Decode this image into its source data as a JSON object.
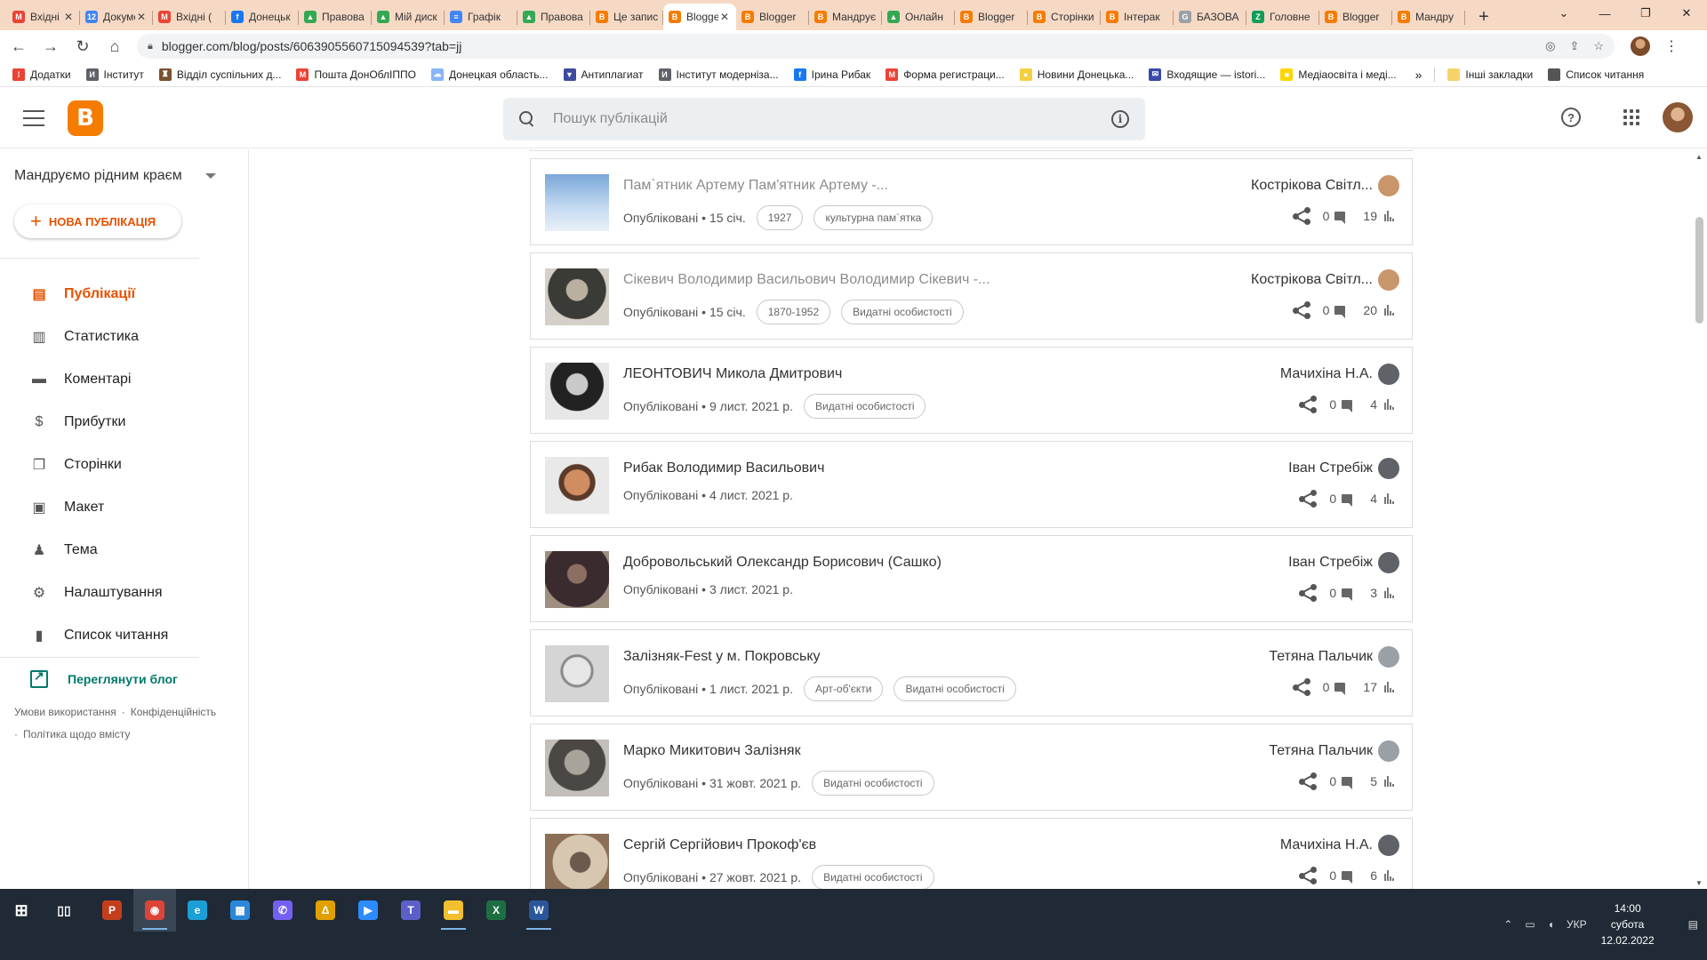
{
  "browser": {
    "tabs": [
      {
        "label": "Вхідні",
        "color": "#ea4335",
        "glyph": "M"
      },
      {
        "label": "Документ",
        "color": "#4285f4",
        "glyph": "12"
      },
      {
        "label": "Вхідні (",
        "color": "#ea4335",
        "glyph": "M"
      },
      {
        "label": "Донецьк",
        "color": "#1877f2",
        "glyph": "f"
      },
      {
        "label": "Правова",
        "color": "#34a853",
        "glyph": "▲"
      },
      {
        "label": "Мій диск",
        "color": "#34a853",
        "glyph": "▲"
      },
      {
        "label": "Графік",
        "color": "#4285f4",
        "glyph": "≡"
      },
      {
        "label": "Правова",
        "color": "#34a853",
        "glyph": "▲"
      },
      {
        "label": "Це запис",
        "color": "#f57c00",
        "glyph": "B"
      },
      {
        "label": "Blogger",
        "color": "#f57c00",
        "glyph": "B",
        "active": true
      },
      {
        "label": "Blogger",
        "color": "#f57c00",
        "glyph": "B"
      },
      {
        "label": "Мандруємо",
        "color": "#f57c00",
        "glyph": "B"
      },
      {
        "label": "Онлайн",
        "color": "#34a853",
        "glyph": "▲"
      },
      {
        "label": "Blogger",
        "color": "#f57c00",
        "glyph": "B"
      },
      {
        "label": "Сторінки",
        "color": "#f57c00",
        "glyph": "B"
      },
      {
        "label": "Інтерак",
        "color": "#f57c00",
        "glyph": "B"
      },
      {
        "label": "БАЗОВА",
        "color": "#9aa0a6",
        "glyph": "G"
      },
      {
        "label": "Головне",
        "color": "#0f9d58",
        "glyph": "Z"
      },
      {
        "label": "Blogger",
        "color": "#f57c00",
        "glyph": "B"
      },
      {
        "label": "Мандру",
        "color": "#f57c00",
        "glyph": "B"
      }
    ],
    "url": "blogger.com/blog/posts/6063905560715094539?tab=jj",
    "bookmarks": [
      {
        "label": "Додатки",
        "color": "#ea4335",
        "glyph": "⁞"
      },
      {
        "label": "Інститут",
        "color": "#5f6368",
        "glyph": "И"
      },
      {
        "label": "Відділ суспільних д...",
        "color": "#7a5230",
        "glyph": "♜"
      },
      {
        "label": "Пошта ДонОблІППО",
        "color": "#ea4335",
        "glyph": "M"
      },
      {
        "label": "Донецкая область...",
        "color": "#8ab4f8",
        "glyph": "☁"
      },
      {
        "label": "Антиплагиат",
        "color": "#3c4ba0",
        "glyph": "▼"
      },
      {
        "label": "Інститут модерніза...",
        "color": "#5f6368",
        "glyph": "И"
      },
      {
        "label": "Ірина Рибак",
        "color": "#1877f2",
        "glyph": "f"
      },
      {
        "label": "Форма регистраци...",
        "color": "#ea4335",
        "glyph": "M"
      },
      {
        "label": "Новини Донецька...",
        "color": "#f4d03f",
        "glyph": "●"
      },
      {
        "label": "Входящие — istori...",
        "color": "#3949ab",
        "glyph": "✉"
      },
      {
        "label": "Медіаосвіта і меді...",
        "color": "#ffd500",
        "glyph": "■"
      }
    ],
    "other_bookmarks": "Інші закладки",
    "reading_list": "Список читання"
  },
  "header": {
    "logo_glyph": "B",
    "search_placeholder": "Пошук публікацій"
  },
  "sidebar": {
    "blog_name": "Мандруємо рідним краєм",
    "new_post": "НОВА ПУБЛІКАЦІЯ",
    "items": [
      {
        "label": "Публікації",
        "icon": "posts-icon",
        "glyph": "▤",
        "active": true
      },
      {
        "label": "Статистика",
        "icon": "stats-icon",
        "glyph": "▥"
      },
      {
        "label": "Коментарі",
        "icon": "comments-icon",
        "glyph": "▬"
      },
      {
        "label": "Прибутки",
        "icon": "earnings-icon",
        "glyph": "$"
      },
      {
        "label": "Сторінки",
        "icon": "pages-icon",
        "glyph": "❐"
      },
      {
        "label": "Макет",
        "icon": "layout-icon",
        "glyph": "▣"
      },
      {
        "label": "Тема",
        "icon": "theme-icon",
        "glyph": "♟"
      },
      {
        "label": "Налаштування",
        "icon": "settings-icon",
        "glyph": "⚙"
      },
      {
        "label": "Список читання",
        "icon": "bookmark-icon",
        "glyph": "▮"
      }
    ],
    "view_blog": "Переглянути блог",
    "footer": {
      "terms": "Умови використання",
      "privacy": "Конфіденційність",
      "content_policy": "Політика щодо вмісту"
    }
  },
  "posts": [
    {
      "title": "Пам`ятник Артему Пам'ятник Артему -...",
      "status": "Опубліковані",
      "date": "15 січ.",
      "labels": [
        "1927",
        "культурна пам`ятка"
      ],
      "author": "Кострікова Світл...",
      "comments": "0",
      "views": "19",
      "muted": true,
      "thumb": "statue",
      "avatar": "#c9956a"
    },
    {
      "title": "Сікевич Володимир Васильович Володимир Сікевич -...",
      "status": "Опубліковані",
      "date": "15 січ.",
      "labels": [
        "1870-1952",
        "Видатні особистості"
      ],
      "author": "Кострікова Світл...",
      "comments": "0",
      "views": "20",
      "muted": true,
      "thumb": "portrait-old",
      "avatar": "#c9956a"
    },
    {
      "title": "ЛЕОНТОВИЧ Микола Дмитрович",
      "status": "Опубліковані",
      "date": "9 лист. 2021 р.",
      "labels": [
        "Видатні особистості"
      ],
      "author": "Мачихіна Н.А.",
      "comments": "0",
      "views": "4",
      "muted": false,
      "thumb": "portrait-bw",
      "avatar": "#5f6368"
    },
    {
      "title": "Рибак Володимир Васильович",
      "status": "Опубліковані",
      "date": "4 лист. 2021 р.",
      "labels": [],
      "author": "Іван Стребіж",
      "comments": "0",
      "views": "4",
      "muted": false,
      "thumb": "portrait-color",
      "avatar": "#5f6368"
    },
    {
      "title": "Добровольський Олександр Борисович (Сашко)",
      "status": "Опубліковані",
      "date": "3 лист. 2021 р.",
      "labels": [],
      "author": "Іван Стребіж",
      "comments": "0",
      "views": "3",
      "muted": false,
      "thumb": "portrait-dark",
      "avatar": "#5f6368"
    },
    {
      "title": "Залізняк-Fest у м. Покровську",
      "status": "Опубліковані",
      "date": "1 лист. 2021 р.",
      "labels": [
        "Арт-об'єкти",
        "Видатні особистості"
      ],
      "author": "Тетяна Пальчик",
      "comments": "0",
      "views": "17",
      "muted": false,
      "thumb": "sketch",
      "avatar": "#9aa0a6"
    },
    {
      "title": "Марко Микитович Залізняк",
      "status": "Опубліковані",
      "date": "31 жовт. 2021 р.",
      "labels": [
        "Видатні особистості"
      ],
      "author": "Тетяна Пальчик",
      "comments": "0",
      "views": "5",
      "muted": false,
      "thumb": "portrait-elder",
      "avatar": "#9aa0a6"
    },
    {
      "title": "Сергій Сергійович Прокоф'єв",
      "status": "Опубліковані",
      "date": "27 жовт. 2021 р.",
      "labels": [
        "Видатні особистості"
      ],
      "author": "Мачихіна Н.А.",
      "comments": "0",
      "views": "6",
      "muted": false,
      "thumb": "composer",
      "avatar": "#5f6368"
    }
  ],
  "taskbar": {
    "apps": [
      {
        "name": "powerpoint-icon",
        "color": "#c43e1c",
        "glyph": "P"
      },
      {
        "name": "chrome-icon",
        "color": "#db4437",
        "glyph": "◉",
        "active": true
      },
      {
        "name": "edge-icon",
        "color": "#1a9fd6",
        "glyph": "e"
      },
      {
        "name": "store-icon",
        "color": "#2b88d8",
        "glyph": "▦"
      },
      {
        "name": "viber-icon",
        "color": "#7360f2",
        "glyph": "✆"
      },
      {
        "name": "app-icon",
        "color": "#e0a100",
        "glyph": "Δ"
      },
      {
        "name": "zoom-icon",
        "color": "#2d8cff",
        "glyph": "▶"
      },
      {
        "name": "teams-icon",
        "color": "#5b5fc7",
        "glyph": "T"
      },
      {
        "name": "explorer-icon",
        "color": "#f2c02e",
        "glyph": "▬",
        "running": true
      },
      {
        "name": "excel-icon",
        "color": "#1d6f42",
        "glyph": "X"
      },
      {
        "name": "word-icon",
        "color": "#2b579a",
        "glyph": "W",
        "running": true
      }
    ],
    "lang": "УКР",
    "time": "14:00",
    "day": "субота",
    "date": "12.02.2022"
  }
}
